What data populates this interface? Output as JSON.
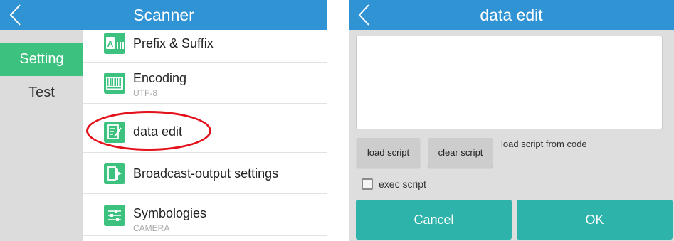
{
  "left": {
    "title": "Scanner",
    "tabs": [
      {
        "label": "Setting",
        "active": true
      },
      {
        "label": "Test",
        "active": false
      }
    ],
    "items": [
      {
        "label": "Prefix & Suffix",
        "sub": "",
        "icon": "prefix-suffix-icon"
      },
      {
        "label": "Encoding",
        "sub": "UTF-8",
        "icon": "barcode-icon"
      },
      {
        "label": "data edit",
        "sub": "",
        "icon": "edit-document-icon"
      },
      {
        "label": "Broadcast-output settings",
        "sub": "",
        "icon": "output-door-icon"
      },
      {
        "label": "Symbologies",
        "sub": "CAMERA",
        "icon": "sliders-icon"
      }
    ]
  },
  "right": {
    "title": "data edit",
    "script_text": "",
    "buttons": {
      "load": "load script",
      "clear": "clear script",
      "cancel": "Cancel",
      "ok": "OK"
    },
    "hint": "load script from code",
    "exec_label": "exec script",
    "exec_checked": false
  },
  "colors": {
    "header": "#2f93d4",
    "tab_active": "#3cc17f",
    "icon_bg": "#3cc17f",
    "action_button": "#2eb3ab",
    "highlight_ring": "#e3121b"
  }
}
